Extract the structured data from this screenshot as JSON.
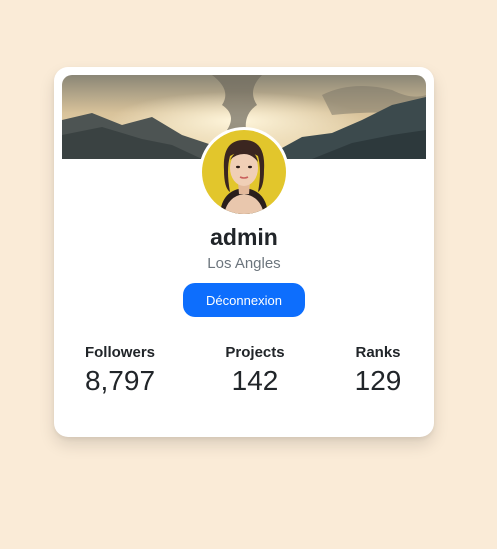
{
  "profile": {
    "name": "admin",
    "location": "Los Angles",
    "logout_label": "Déconnexion"
  },
  "stats": [
    {
      "label": "Followers",
      "value": "8,797"
    },
    {
      "label": "Projects",
      "value": "142"
    },
    {
      "label": "Ranks",
      "value": "129"
    }
  ],
  "colors": {
    "page_background": "#faebd7",
    "card_background": "#ffffff",
    "button": "#0d6efd",
    "muted_text": "#6c757d"
  }
}
